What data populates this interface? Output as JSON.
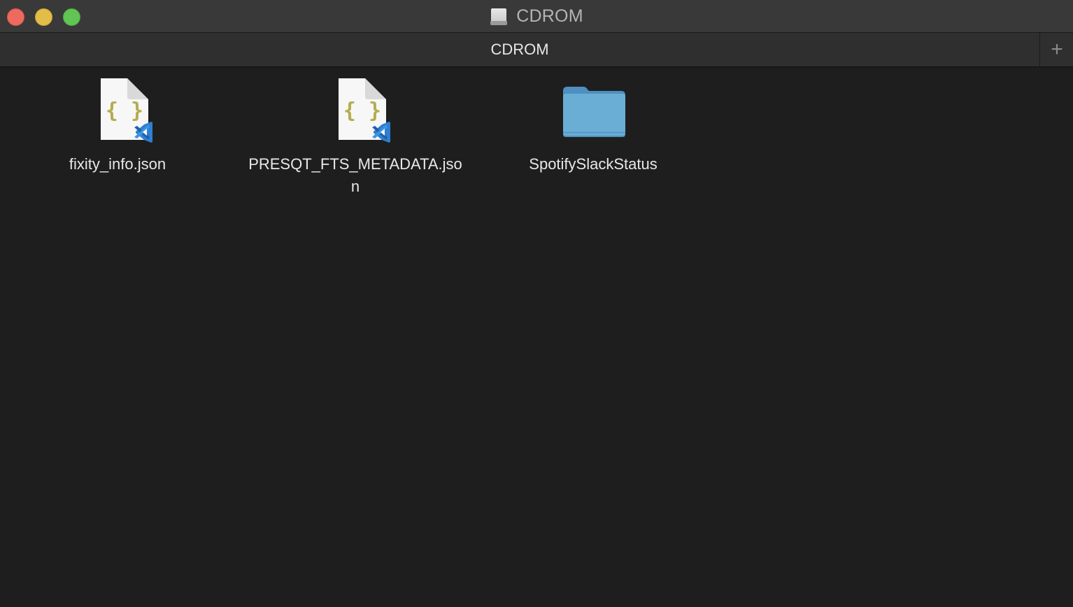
{
  "window": {
    "title": "CDROM",
    "title_icon": "drive-icon",
    "controls": {
      "close": "close-button",
      "minimize": "minimize-button",
      "zoom": "zoom-button"
    }
  },
  "tabs": {
    "active_label": "CDROM",
    "new_tab_symbol": "+"
  },
  "files": [
    {
      "name": "fixity_info.json",
      "kind": "json-file",
      "icon": "json-file-icon"
    },
    {
      "name": "PRESQT_FTS_METADATA.json",
      "kind": "json-file",
      "icon": "json-file-icon"
    },
    {
      "name": "SpotifySlackStatus",
      "kind": "folder",
      "icon": "folder-icon"
    }
  ],
  "colors": {
    "background": "#1e1e1e",
    "titlebar": "#393939",
    "tabbar": "#2f2f2f",
    "close": "#ed6a5e",
    "minimize": "#e2bd4a",
    "zoom": "#61c454",
    "folder": "#6aaed6",
    "json_braces": "#b4ad4e",
    "vscode_blue": "#2f7fd1"
  }
}
